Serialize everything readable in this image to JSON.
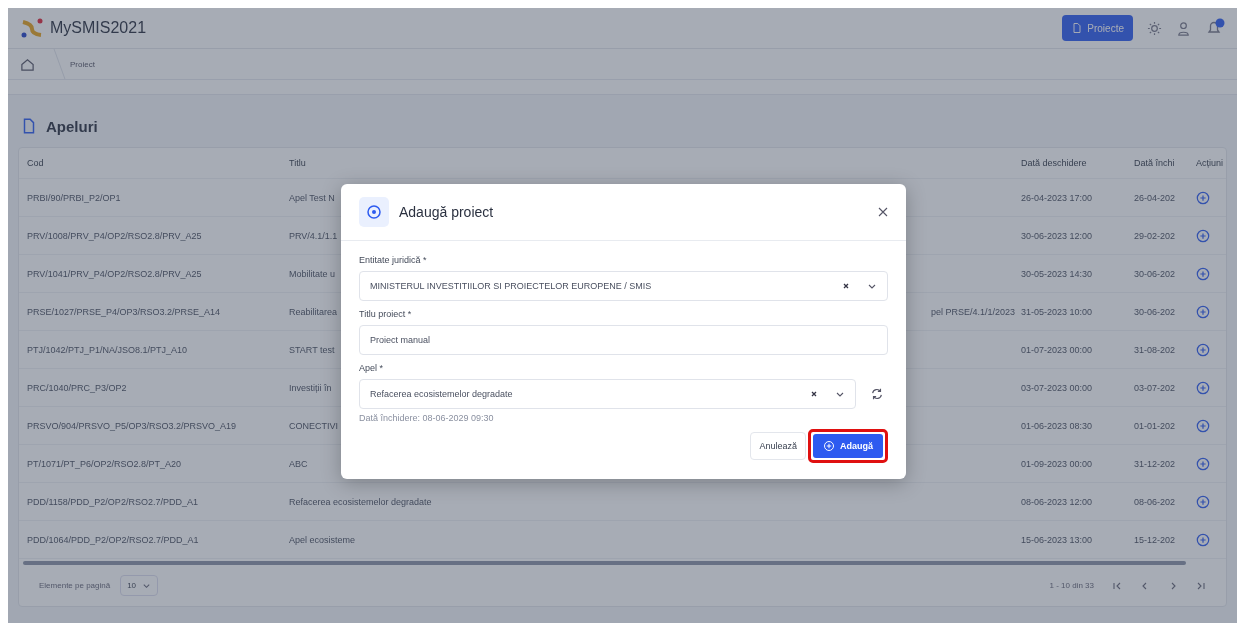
{
  "app": {
    "name": "MySMIS2021",
    "projects_button": "Proiecte"
  },
  "breadcrumb": [
    "Proiect"
  ],
  "section": {
    "title": "Apeluri"
  },
  "table": {
    "columns": [
      "Cod",
      "Titlu",
      "Dată deschidere",
      "Dată închi",
      "Acțiuni"
    ],
    "rows": [
      {
        "code": "PRBI/90/PRBI_P2/OP1",
        "title": "Apel Test N",
        "title_tail": "",
        "opened": "26-04-2023 17:00",
        "closed": "26-04-202"
      },
      {
        "code": "PRV/1008/PRV_P4/OP2/RSO2.8/PRV_A25",
        "title": "PRV/4.1/1.1",
        "title_tail": "",
        "opened": "30-06-2023 12:00",
        "closed": "29-02-202"
      },
      {
        "code": "PRV/1041/PRV_P4/OP2/RSO2.8/PRV_A25",
        "title": "Mobilitate u",
        "title_tail": "",
        "opened": "30-05-2023 14:30",
        "closed": "30-06-202"
      },
      {
        "code": "PRSE/1027/PRSE_P4/OP3/RSO3.2/PRSE_A14",
        "title": "Reabilitarea",
        "title_tail": "pel PRSE/4.1/1/2023",
        "opened": "31-05-2023 10:00",
        "closed": "30-06-202"
      },
      {
        "code": "PTJ/1042/PTJ_P1/NA/JSO8.1/PTJ_A10",
        "title": "START test",
        "title_tail": "",
        "opened": "01-07-2023 00:00",
        "closed": "31-08-202"
      },
      {
        "code": "PRC/1040/PRC_P3/OP2",
        "title": "Investiții în",
        "title_tail": "",
        "opened": "03-07-2023 00:00",
        "closed": "03-07-202"
      },
      {
        "code": "PRSVO/904/PRSVO_P5/OP3/RSO3.2/PRSVO_A19",
        "title": "CONECTIVI",
        "title_tail": "",
        "opened": "01-06-2023 08:30",
        "closed": "01-01-202"
      },
      {
        "code": "PT/1071/PT_P6/OP2/RSO2.8/PT_A20",
        "title": "ABC",
        "title_tail": "",
        "opened": "01-09-2023 00:00",
        "closed": "31-12-202"
      },
      {
        "code": "PDD/1158/PDD_P2/OP2/RSO2.7/PDD_A1",
        "title": "Refacerea ecosistemelor degradate",
        "title_tail": "",
        "opened": "08-06-2023 12:00",
        "closed": "08-06-202"
      },
      {
        "code": "PDD/1064/PDD_P2/OP2/RSO2.7/PDD_A1",
        "title": "Apel ecosisteme",
        "title_tail": "",
        "opened": "15-06-2023 13:00",
        "closed": "15-12-202"
      }
    ]
  },
  "pagination": {
    "per_page_label": "Elemente pe pagină",
    "per_page": "10",
    "range": "1 - 10 din 33"
  },
  "dialog": {
    "title": "Adaugă proiect",
    "fields": [
      {
        "kind": "select",
        "label": "Entitate juridică *",
        "value": "MINISTERUL INVESTITIILOR SI PROIECTELOR EUROPENE / SMIS",
        "refresh": false
      },
      {
        "kind": "text",
        "label": "Titlu proiect *",
        "value": "Proiect manual",
        "refresh": false
      },
      {
        "kind": "select",
        "label": "Apel *",
        "value": "Refacerea ecosistemelor degradate",
        "refresh": true
      }
    ],
    "hint": "Dată închidere: 08-06-2029 09:30",
    "cancel": "Anulează",
    "submit": "Adaugă"
  }
}
